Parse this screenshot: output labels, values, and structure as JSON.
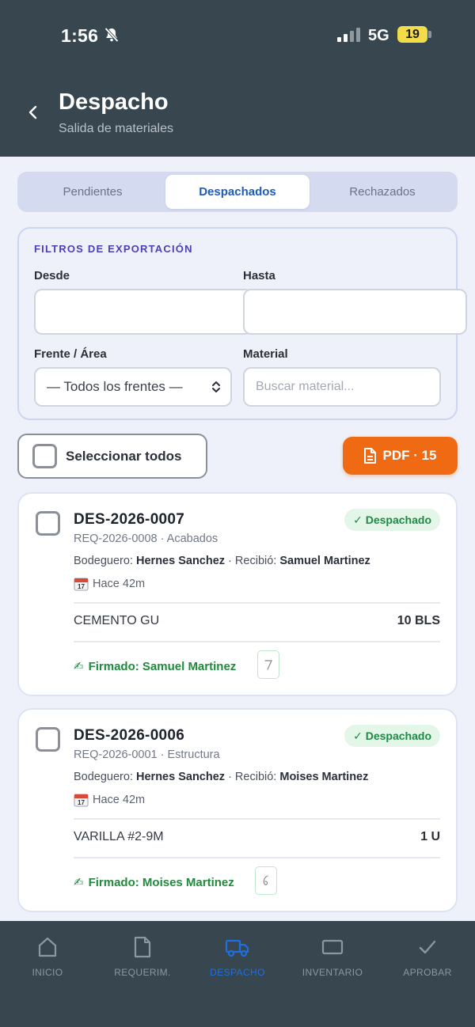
{
  "status_bar": {
    "time": "1:56",
    "network": "5G",
    "battery": "19"
  },
  "header": {
    "title": "Despacho",
    "subtitle": "Salida de materiales"
  },
  "tabs": [
    {
      "label": "Pendientes",
      "active": false
    },
    {
      "label": "Despachados",
      "active": true
    },
    {
      "label": "Rechazados",
      "active": false
    }
  ],
  "filters": {
    "title": "FILTROS DE EXPORTACIÓN",
    "desde_label": "Desde",
    "desde_value": "",
    "hasta_label": "Hasta",
    "hasta_value": "",
    "frente_label": "Frente / Área",
    "frente_value": "— Todos los frentes —",
    "material_label": "Material",
    "material_placeholder": "Buscar material..."
  },
  "actions": {
    "select_all_label": "Seleccionar todos",
    "pdf_label": "PDF · 15"
  },
  "dispatches": [
    {
      "id": "DES-2026-0007",
      "req": "REQ-2026-0008 · Acabados",
      "warehouse_label": "Bodeguero:",
      "warehouse_name": "Hernes Sanchez",
      "receiver_label": "· Recibió:",
      "receiver_name": "Samuel Martinez",
      "time": "Hace 42m",
      "status": "✓ Despachado",
      "item": "CEMENTO GU",
      "qty": "10 BLS",
      "signed": "Firmado: Samuel Martinez"
    },
    {
      "id": "DES-2026-0006",
      "req": "REQ-2026-0001 · Estructura",
      "warehouse_label": "Bodeguero:",
      "warehouse_name": "Hernes Sanchez",
      "receiver_label": "· Recibió:",
      "receiver_name": "Moises Martinez",
      "time": "Hace 42m",
      "status": "✓ Despachado",
      "item": "VARILLA #2-9M",
      "qty": "1 U",
      "signed": "Firmado: Moises Martinez"
    }
  ],
  "bottom_nav": [
    {
      "label": "INICIO",
      "icon": "home-icon",
      "active": false
    },
    {
      "label": "REQUERIM.",
      "icon": "document-icon",
      "active": false
    },
    {
      "label": "DESPACHO",
      "icon": "truck-icon",
      "active": true
    },
    {
      "label": "INVENTARIO",
      "icon": "box-icon",
      "active": false
    },
    {
      "label": "APROBAR",
      "icon": "check-icon",
      "active": false
    }
  ],
  "colors": {
    "header_bg": "#37464f",
    "accent_blue": "#1f5bb8",
    "pdf_orange": "#ef6a12",
    "success_green": "#1e8a45",
    "filters_title": "#4b3fb8"
  }
}
